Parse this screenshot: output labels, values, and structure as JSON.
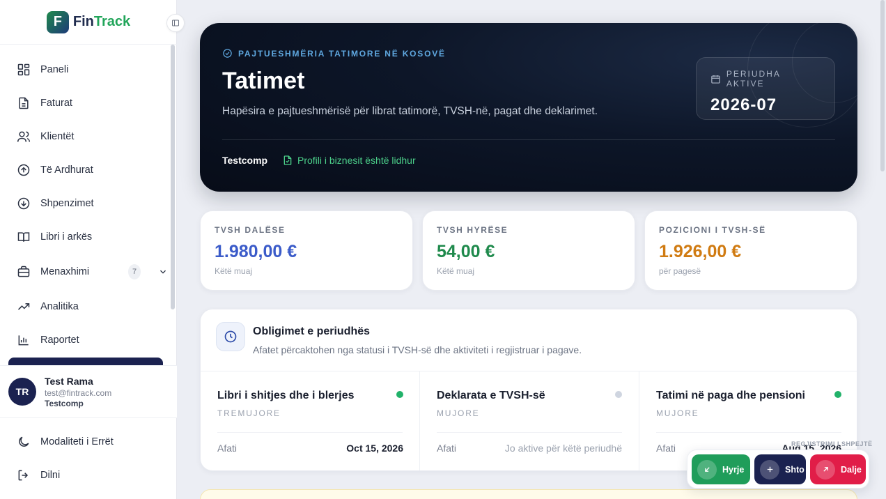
{
  "brand": {
    "name_part1": "Fin",
    "name_part2": "Track"
  },
  "sidebar": {
    "items": [
      {
        "label": "Paneli"
      },
      {
        "label": "Faturat"
      },
      {
        "label": "Klientët"
      },
      {
        "label": "Të Ardhurat"
      },
      {
        "label": "Shpenzimet"
      },
      {
        "label": "Libri i arkës"
      },
      {
        "label": "Menaxhimi",
        "badge": "7"
      },
      {
        "label": "Analitika"
      },
      {
        "label": "Raportet"
      }
    ],
    "user": {
      "initials": "TR",
      "name": "Test Rama",
      "email": "test@fintrack.com",
      "company": "Testcomp"
    },
    "bottom": [
      {
        "label": "Modaliteti i Errët"
      },
      {
        "label": "Dilni"
      }
    ]
  },
  "hero": {
    "eyebrow": "PAJTUESHMËRIA TATIMORE NË KOSOVË",
    "title": "Tatimet",
    "subtitle": "Hapësira e pajtueshmërisë për librat tatimorë, TVSH-në, pagat dhe deklarimet.",
    "company": "Testcomp",
    "linked_status": "Profili i biznesit është lidhur",
    "period_label": "PERIUDHA AKTIVE",
    "period_value": "2026-07"
  },
  "stats": [
    {
      "label": "TVSH DALËSE",
      "value": "1.980,00 €",
      "note": "Këtë muaj",
      "color": "#3b5bc9"
    },
    {
      "label": "TVSH HYRËSE",
      "value": "54,00 €",
      "note": "Këtë muaj",
      "color": "#1f8a4c"
    },
    {
      "label": "POZICIONI I TVSH-SË",
      "value": "1.926,00 €",
      "note": "për pagesë",
      "color": "#d07b12"
    }
  ],
  "obligations": {
    "title": "Obligimet e periudhës",
    "subtitle": "Afatet përcaktohen nga statusi i TVSH-së dhe aktiviteti i regjistruar i pagave.",
    "deadline_label": "Afati",
    "items": [
      {
        "name": "Libri i shitjes dhe i blerjes",
        "frequency": "TREMUJORE",
        "deadline": "Oct 15, 2026",
        "status_color": "#22b26a"
      },
      {
        "name": "Deklarata e TVSH-së",
        "frequency": "MUJORE",
        "deadline": "Jo aktive për këtë periudhë",
        "status_color": "#cfd5e0"
      },
      {
        "name": "Tatimi në paga dhe pensioni",
        "frequency": "MUJORE",
        "deadline": "Aug 15, 2026",
        "status_color": "#22b26a"
      }
    ]
  },
  "quick_actions": {
    "title": "REGJISTRIMI I SHPEJTË",
    "buttons": [
      {
        "label": "Hyrje",
        "color": "#1f9d5a"
      },
      {
        "label": "Shto",
        "color": "#1b2250"
      },
      {
        "label": "Dalje",
        "color": "#e11d48"
      }
    ]
  }
}
